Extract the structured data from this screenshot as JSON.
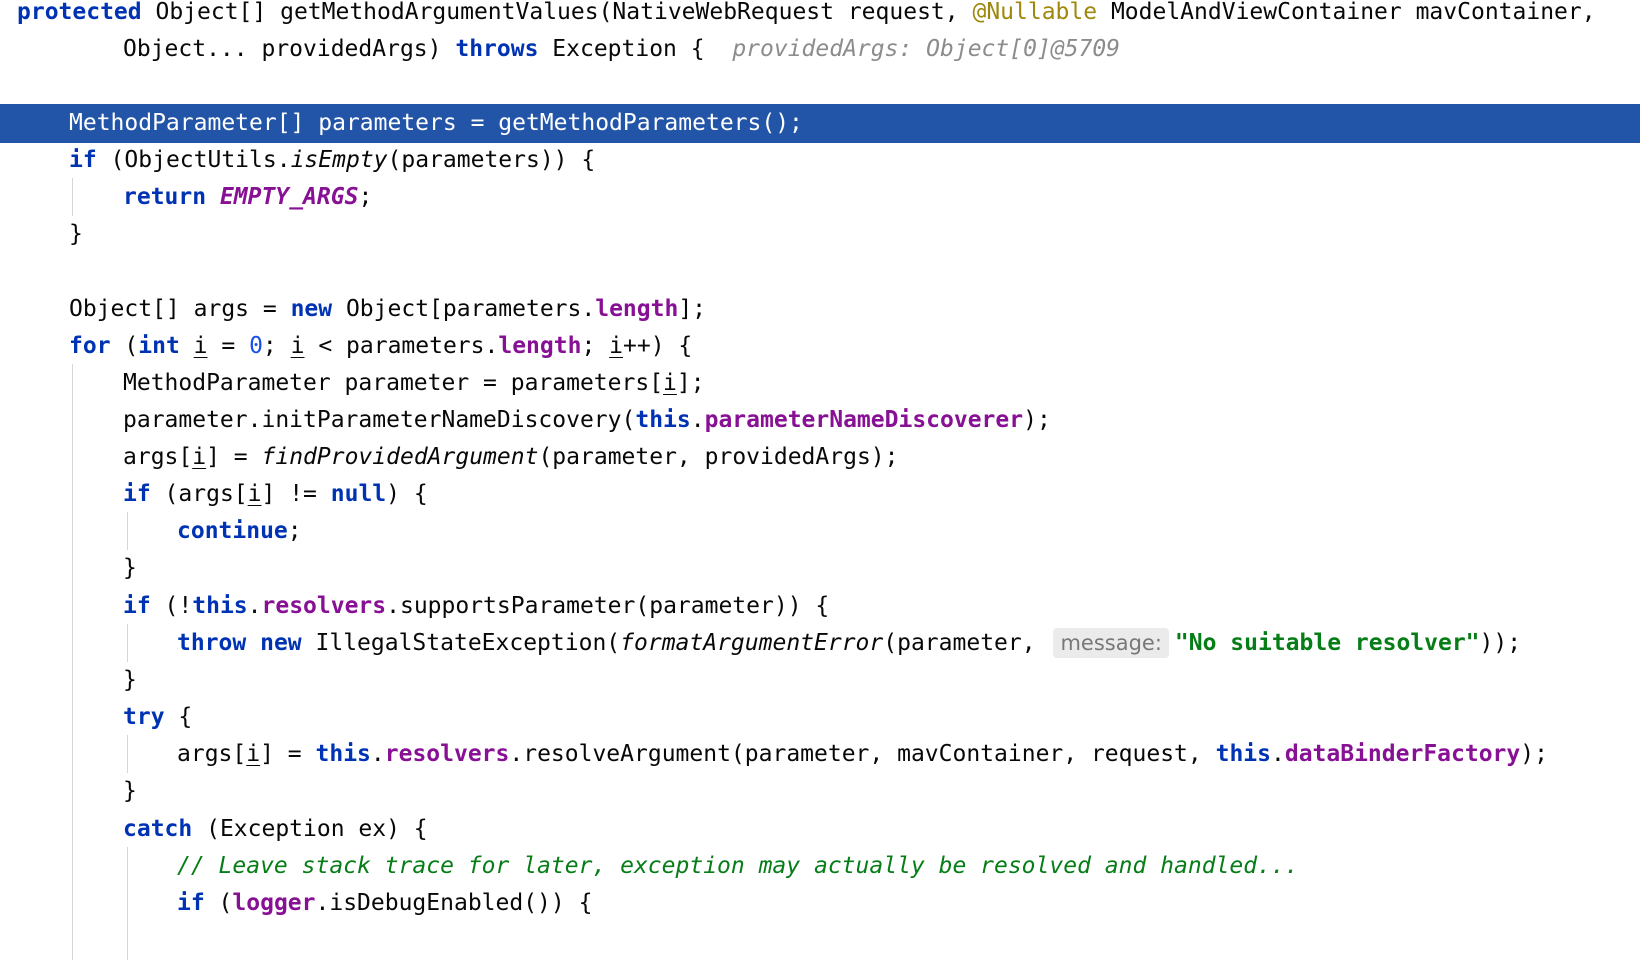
{
  "editor": {
    "language": "Java",
    "colors": {
      "keyword": "#0033b3",
      "annotation": "#9e880d",
      "field": "#871094",
      "string": "#067d17",
      "comment": "#8c8c8c",
      "number": "#1750eb",
      "current_line_bg": "#2255a8"
    },
    "lines": {
      "l1": {
        "kw_protected": "protected",
        "t1": " Object[] getMethodArgumentValues(NativeWebRequest request, ",
        "ann": "@Nullable",
        "t2": " ModelAndViewContainer mavContainer,"
      },
      "l2": {
        "t1": "Object... providedArgs) ",
        "kw_throws": "throws",
        "t2": " Exception {  ",
        "hint": "providedArgs: Object[0]@5709"
      },
      "l4": {
        "t1": "MethodParameter[] parameters = getMethodParameters();"
      },
      "l5": {
        "kw_if": "if",
        "t1": " (ObjectUtils.",
        "m": "isEmpty",
        "t2": "(parameters)) {"
      },
      "l6": {
        "kw_return": "return",
        "t1": " ",
        "c": "EMPTY_ARGS",
        "t2": ";"
      },
      "l7": {
        "t1": "}"
      },
      "l9": {
        "t1": "Object[] args = ",
        "kw_new": "new",
        "t2": " Object[parameters.",
        "f": "length",
        "t3": "];"
      },
      "l10": {
        "kw_for": "for",
        "t1": " (",
        "kw_int": "int",
        "t2": " ",
        "v1": "i",
        "t3": " = ",
        "n": "0",
        "t4": "; ",
        "v2": "i",
        "t5": " < parameters.",
        "f": "length",
        "t6": "; ",
        "v3": "i",
        "t7": "++) {"
      },
      "l11": {
        "t1": "MethodParameter parameter = parameters[",
        "v": "i",
        "t2": "];"
      },
      "l12": {
        "t1": "parameter.initParameterNameDiscovery(",
        "kw_this": "this",
        "t2": ".",
        "f": "parameterNameDiscoverer",
        "t3": ");"
      },
      "l13": {
        "t1": "args[",
        "v": "i",
        "t2": "] = ",
        "m": "findProvidedArgument",
        "t3": "(parameter, providedArgs);"
      },
      "l14": {
        "kw_if": "if",
        "t1": " (args[",
        "v": "i",
        "t2": "] != ",
        "kw_null": "null",
        "t3": ") {"
      },
      "l15": {
        "kw_continue": "continue",
        "t1": ";"
      },
      "l16": {
        "t1": "}"
      },
      "l17": {
        "kw_if": "if",
        "t1": " (!",
        "kw_this": "this",
        "t2": ".",
        "f": "resolvers",
        "t3": ".supportsParameter(parameter)) {"
      },
      "l18": {
        "kw_throw": "throw",
        "t0": " ",
        "kw_new": "new",
        "t1": " IllegalStateException(",
        "m": "formatArgumentError",
        "t2": "(parameter, ",
        "hint": "message:",
        "s": "\"No suitable resolver\"",
        "t3": "));"
      },
      "l19": {
        "t1": "}"
      },
      "l20": {
        "kw_try": "try",
        "t1": " {"
      },
      "l21": {
        "t1": "args[",
        "v": "i",
        "t2": "] = ",
        "kw_this1": "this",
        "t3": ".",
        "f1": "resolvers",
        "t4": ".resolveArgument(parameter, mavContainer, request, ",
        "kw_this2": "this",
        "t5": ".",
        "f2": "dataBinderFactory",
        "t6": ");"
      },
      "l22": {
        "t1": "}"
      },
      "l23": {
        "kw_catch": "catch",
        "t1": " (Exception ex) {"
      },
      "l24": {
        "cmt": "// Leave stack trace for later, exception may actually be resolved and handled..."
      },
      "l25": {
        "kw_if": "if",
        "t1": " (",
        "f": "logger",
        "t2": ".isDebugEnabled()) {"
      }
    }
  }
}
